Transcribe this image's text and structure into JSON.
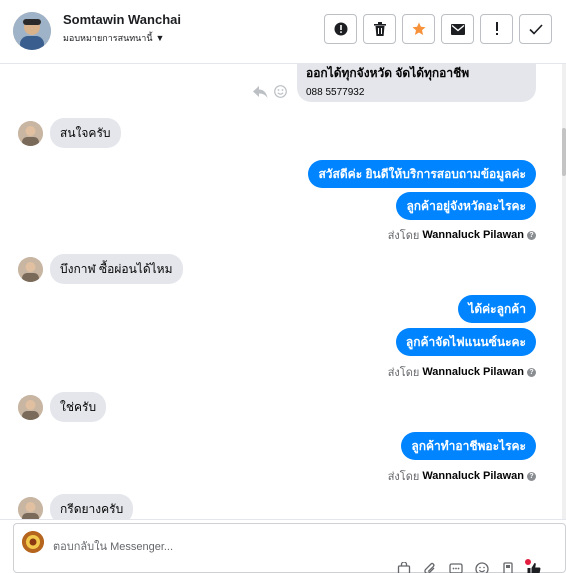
{
  "header": {
    "contact_name": "Somtawin Wanchai",
    "assign_label": "มอบหมายการสนทนานี้",
    "actions": [
      {
        "name": "report-button",
        "icon": "exclamation-circle-icon",
        "color": "#1c1e21"
      },
      {
        "name": "delete-button",
        "icon": "trash-icon",
        "color": "#1c1e21"
      },
      {
        "name": "star-button",
        "icon": "star-icon",
        "color": "#f7923a"
      },
      {
        "name": "mark-unread-button",
        "icon": "envelope-icon",
        "color": "#1c1e21"
      },
      {
        "name": "spam-button",
        "icon": "exclamation-icon",
        "color": "#1c1e21"
      },
      {
        "name": "done-button",
        "icon": "check-icon",
        "color": "#1c1e21"
      }
    ]
  },
  "conversation": {
    "card": {
      "title": "ออกได้ทุกจังหวัด จัดได้ทุกอาชีพ",
      "phone": "088 5577932"
    },
    "incoming": [
      {
        "text": "สนใจครับ"
      },
      {
        "text": "บึงกาฬ ซื้อผ่อนได้ไหม"
      },
      {
        "text": "ใช่ครับ"
      },
      {
        "text": "กรีดยางครับ"
      }
    ],
    "outgoing_groups": [
      {
        "messages": [
          "สวัสดีค่ะ  ยินดีให้บริการสอบถามข้อมูลค่ะ",
          "ลูกค้าอยู่จังหวัดอะไรคะ"
        ],
        "sent_by_prefix": "ส่งโดย",
        "sent_by_name": "Wannaluck Pilawan"
      },
      {
        "messages": [
          "ได้ค่ะลูกค้า",
          "ลูกค้าจัดไฟแนนซ์นะคะ"
        ],
        "sent_by_prefix": "ส่งโดย",
        "sent_by_name": "Wannaluck Pilawan"
      },
      {
        "messages": [
          "ลูกค้าทำอาชีพอะไรคะ"
        ],
        "sent_by_prefix": "ส่งโดย",
        "sent_by_name": "Wannaluck Pilawan"
      }
    ]
  },
  "composer": {
    "placeholder": "ตอบกลับใน Messenger...",
    "tools": [
      "bag-icon",
      "paperclip-icon",
      "chat-template-icon",
      "emoji-icon",
      "sticker-icon",
      "like-icon"
    ]
  },
  "colors": {
    "outgoing_bubble": "#0084ff",
    "incoming_bubble": "#e4e6eb",
    "accent_star": "#f7923a",
    "notification_dot": "#e41e3f"
  }
}
